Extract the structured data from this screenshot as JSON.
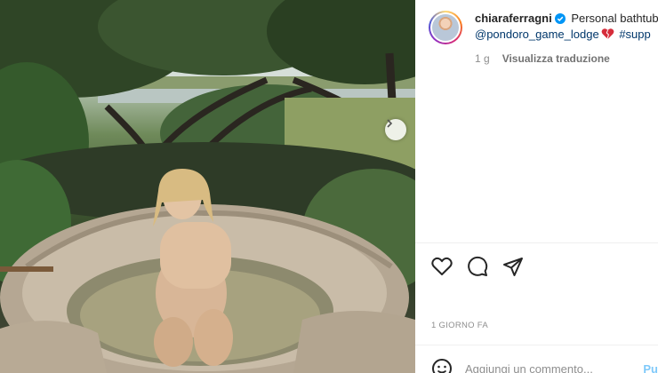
{
  "post": {
    "username": "chiaraferragni",
    "caption_text": "Personal bathtub",
    "mention": "@pondoro_game_lodge",
    "hashtag": "#supp",
    "time_ago": "1 g",
    "translate_label": "Visualizza traduzione",
    "date_label": "1 GIORNO FA"
  },
  "comment": {
    "placeholder": "Aggiungi un commento...",
    "post_label": "Pu"
  },
  "icons": {
    "verified": "verified-badge-icon",
    "heart_emoji": "broken-heart-emoji-icon",
    "like": "heart-icon",
    "comment": "comment-bubble-icon",
    "share": "paper-plane-icon",
    "emoji": "emoji-smiley-icon",
    "next": "chevron-right-icon"
  },
  "colors": {
    "link": "#00376b",
    "verified": "#0095f6",
    "post_button": "#0095f6",
    "muted": "#8e8e8e"
  }
}
